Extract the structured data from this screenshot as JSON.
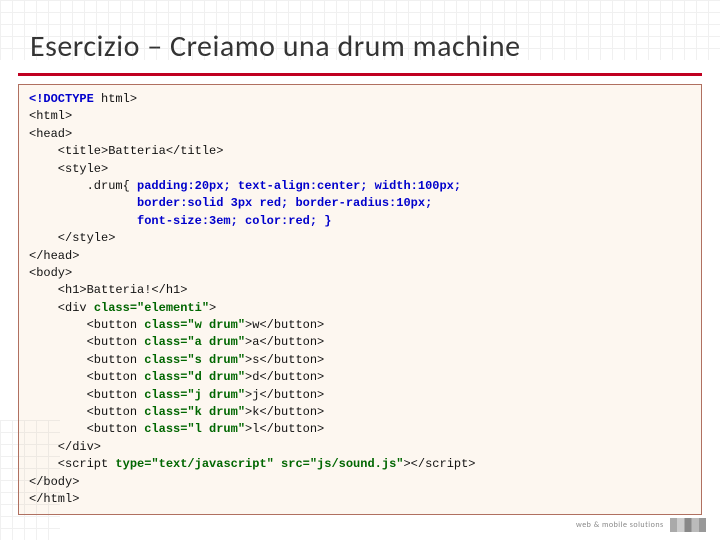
{
  "slide": {
    "title": "Esercizio – Creiamo una drum machine"
  },
  "code": {
    "l01a": "<!DOCTYPE",
    "l01b": " html>",
    "l02": "<html>",
    "l03": "<head>",
    "l04a": "    <title>",
    "l04b": "Batteria",
    "l04c": "</title>",
    "l05": "    <style>",
    "l06a": "        .drum{ ",
    "l06b": "padding:20px; text-align:center; width:100px;",
    "l07": "               border:solid 3px red; border-radius:10px;",
    "l08": "               font-size:3em; color:red; }",
    "l09": "    </style>",
    "l10": "</head>",
    "l11": "<body>",
    "l12a": "    <h1>",
    "l12b": "Batteria!",
    "l12c": "</h1>",
    "l13a": "    <div ",
    "l13b": "class=\"elementi\"",
    "l13c": ">",
    "b1a": "        <button ",
    "b1b": "class=\"w drum\"",
    "b1c": ">w</button>",
    "b2a": "        <button ",
    "b2b": "class=\"a drum\"",
    "b2c": ">a</button>",
    "b3a": "        <button ",
    "b3b": "class=\"s drum\"",
    "b3c": ">s</button>",
    "b4a": "        <button ",
    "b4b": "class=\"d drum\"",
    "b4c": ">d</button>",
    "b5a": "        <button ",
    "b5b": "class=\"j drum\"",
    "b5c": ">j</button>",
    "b6a": "        <button ",
    "b6b": "class=\"k drum\"",
    "b6c": ">k</button>",
    "b7a": "        <button ",
    "b7b": "class=\"l drum\"",
    "b7c": ">l</button>",
    "l15": "    </div>",
    "l16a": "    <script ",
    "l16b": "type=\"text/javascript\" src=\"js/sound.js\"",
    "l16c": "></scr",
    "l16d": "ipt>",
    "l17": "</body>",
    "l18": "</html>"
  },
  "footer": "web & mobile solutions"
}
